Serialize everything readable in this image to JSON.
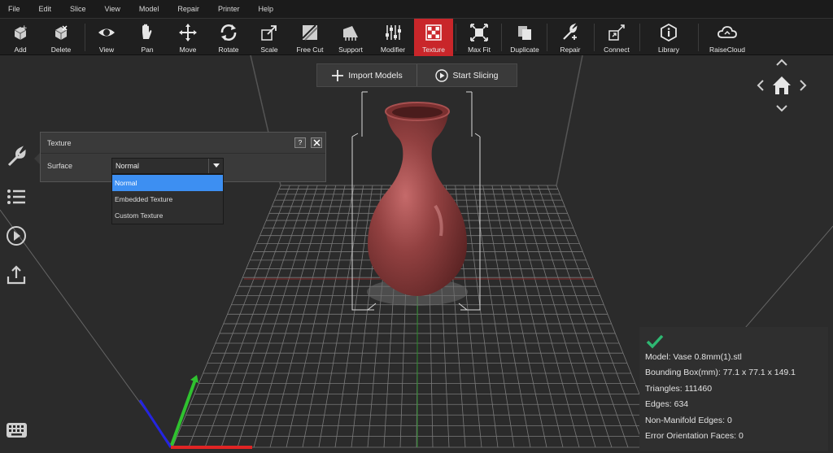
{
  "menu": [
    "File",
    "Edit",
    "Slice",
    "View",
    "Model",
    "Repair",
    "Printer",
    "Help"
  ],
  "toolbar": {
    "tools": [
      {
        "label": "Add",
        "icon": "add-cube-icon"
      },
      {
        "label": "Delete",
        "icon": "delete-cube-icon"
      },
      {
        "label": "View",
        "icon": "eye-icon"
      },
      {
        "label": "Pan",
        "icon": "hand-icon"
      },
      {
        "label": "Move",
        "icon": "move-arrows-icon"
      },
      {
        "label": "Rotate",
        "icon": "rotate-icon"
      },
      {
        "label": "Scale",
        "icon": "scale-icon"
      },
      {
        "label": "Free Cut",
        "icon": "free-cut-icon"
      },
      {
        "label": "Support",
        "icon": "support-icon"
      },
      {
        "label": "Modifier",
        "icon": "modifier-sliders-icon"
      },
      {
        "label": "Texture",
        "icon": "texture-checker-icon",
        "active": true
      },
      {
        "label": "Max Fit",
        "icon": "max-fit-icon"
      },
      {
        "label": "Duplicate",
        "icon": "duplicate-icon"
      },
      {
        "label": "Repair",
        "icon": "repair-wrench-icon"
      },
      {
        "label": "Connect",
        "icon": "connect-icon"
      },
      {
        "label": "Library",
        "icon": "library-info-icon"
      },
      {
        "label": "RaiseCloud",
        "icon": "cloud-icon"
      }
    ]
  },
  "topbar": {
    "import_label": "Import Models",
    "start_label": "Start Slicing"
  },
  "texture_panel": {
    "title": "Texture",
    "help_label": "?",
    "surface_label": "Surface",
    "selected": "Normal",
    "options": [
      "Normal",
      "Embedded Texture",
      "Custom Texture"
    ]
  },
  "model_info": {
    "model": "Model: Vase 0.8mm(1).stl",
    "bounding_box": "Bounding Box(mm): 77.1 x 77.1 x 149.1",
    "triangles": "Triangles: 111460",
    "edges": "Edges: 634",
    "non_manifold": "Non-Manifold Edges: 0",
    "error_faces": "Error Orientation Faces: 0"
  },
  "colors": {
    "active_tool": "#c9262a",
    "model": "#8e3a3a",
    "dropdown_selected": "#3d8ff2",
    "check": "#2eb872"
  }
}
